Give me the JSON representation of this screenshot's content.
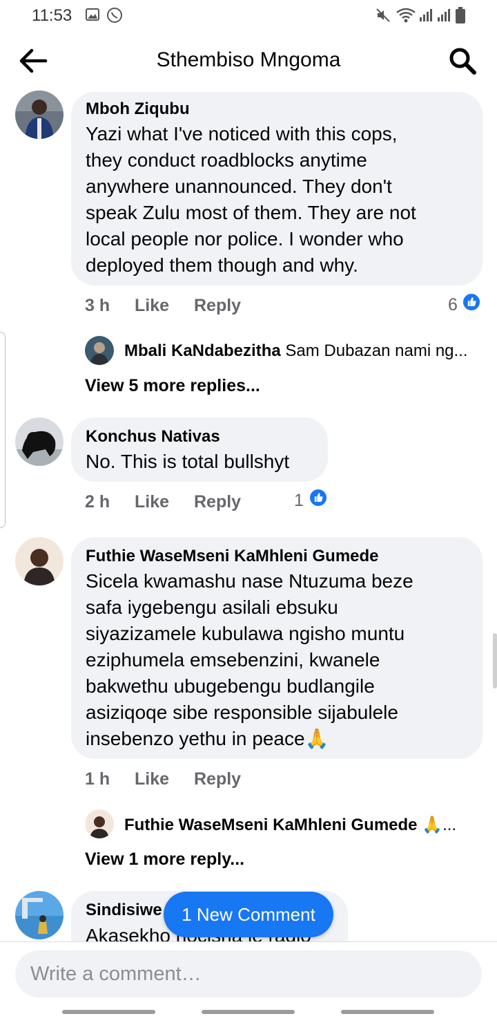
{
  "status_bar": {
    "time": "11:53",
    "left_icons": [
      "photo-icon",
      "whatsapp-icon"
    ],
    "right_icons": [
      "mute-icon",
      "wifi-icon",
      "signal-icon",
      "signal-icon",
      "battery-icon"
    ]
  },
  "header": {
    "title": "Sthembiso Mngoma",
    "back_icon": "back-arrow-icon",
    "search_icon": "search-icon"
  },
  "colors": {
    "accent": "#1877f2",
    "bubble": "#f0f2f5",
    "meta_text": "#65676b"
  },
  "comments": [
    {
      "author": "Mboh Ziqubu",
      "text": "Yazi what I've noticed with this cops,\nthey conduct roadblocks anytime\nanywhere unannounced. They don't\nspeak Zulu most of them. They are not\nlocal people nor police. I wonder who\ndeployed them though and why.",
      "time": "3 h",
      "like_label": "Like",
      "reply_label": "Reply",
      "reactions": "6",
      "reply_preview": {
        "author": "Mbali KaNdabezitha",
        "text": "Sam Dubazan nami ng..."
      },
      "view_more": "View 5 more replies..."
    },
    {
      "author": "Konchus Nativas",
      "text": "No. This is total bullshyt",
      "time": "2 h",
      "like_label": "Like",
      "reply_label": "Reply",
      "reactions": "1"
    },
    {
      "author": "Futhie WaseMseni KaMhleni Gumede",
      "text": "Sicela kwamashu nase Ntuzuma beze\nsafa iygebengu asilali ebsuku\nsiyazizamele kubulawa ngisho muntu\neziphumela emsebenzini, kwanele\nbakwethu ubugebengu budlangile\nasiziqoqe sibe responsible sijabulele\ninsebenzo yethu in peace🙏",
      "time": "1 h",
      "like_label": "Like",
      "reply_label": "Reply",
      "reply_preview": {
        "author": "Futhie WaseMseni KaMhleni Gumede",
        "text": "🙏..."
      },
      "view_more": "View 1 more reply..."
    },
    {
      "author": "Sindisiwe",
      "text": "Akasekho nocisha le radio"
    }
  ],
  "new_comment_pill": "1 New Comment",
  "composer": {
    "placeholder": "Write a comment…"
  }
}
